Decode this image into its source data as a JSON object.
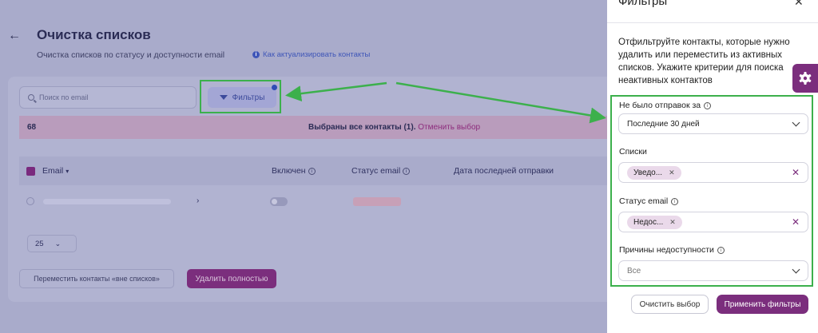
{
  "page": {
    "back_icon": "arrow-left-icon",
    "title": "Очистка списков",
    "subtitle": "Очистка списков по статусу и доступности email",
    "help_link": "Как актуализировать контакты"
  },
  "toolbar": {
    "search_placeholder": "Поиск по email",
    "filters_label": "Фильтры"
  },
  "selection": {
    "count": "68",
    "message": "Выбраны все контакты (1).",
    "cancel_label": "Отменить выбор"
  },
  "table": {
    "columns": [
      "Email",
      "Включен",
      "Статус email",
      "Дата последней отправки"
    ]
  },
  "pagination": {
    "per_page": "25"
  },
  "actions": {
    "move_label": "Переместить контакты «вне списков»",
    "delete_label": "Удалить полностью"
  },
  "panel": {
    "title": "Фильтры",
    "close_icon": "close-icon",
    "description": "Отфильтруйте контакты, которые нужно удалить или переместить из активных списков. Укажите критерии для поиска неактивных контактов",
    "fields": {
      "no_sends": {
        "label": "Не было отправок за",
        "value": "Последние 30 дней"
      },
      "lists": {
        "label": "Списки",
        "chip": "Уведо..."
      },
      "email_status": {
        "label": "Статус email",
        "chip": "Недос..."
      },
      "reasons": {
        "label": "Причины недоступности",
        "value": "Все"
      }
    },
    "clear_label": "Очистить выбор",
    "apply_label": "Применить фильтры"
  },
  "colors": {
    "accent": "#7b2e7d",
    "highlight": "#3cb04c",
    "overlay": "#a9abcb"
  }
}
